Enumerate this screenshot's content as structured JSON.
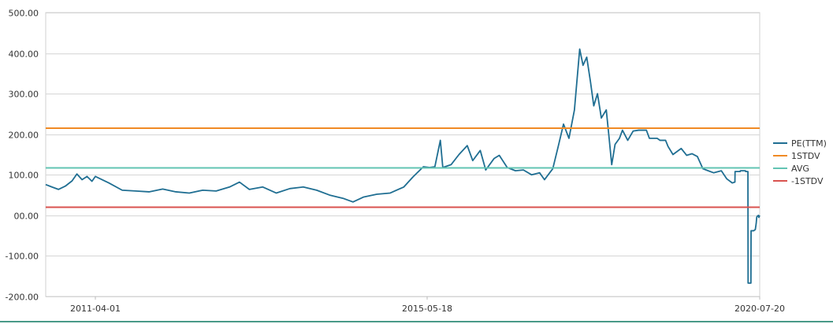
{
  "chart_data": {
    "type": "line",
    "title": "",
    "xlabel": "",
    "ylabel": "",
    "ylim": [
      -200,
      500
    ],
    "y_ticks": [
      "500.00",
      "400.00",
      "300.00",
      "200.00",
      "100.00",
      "00.00",
      "-100.00",
      "-200.00"
    ],
    "y_tick_values": [
      500,
      400,
      300,
      200,
      100,
      0,
      -100,
      -200
    ],
    "x_ticks": [
      "2011-04-01",
      "2015-05-18",
      "2020-07-20"
    ],
    "x_range": [
      "2010-01-04",
      "2020-07-20"
    ],
    "grid": "horizontal",
    "legend_position": "right",
    "series": [
      {
        "name": "PE(TTM)",
        "color": "#1f6e92",
        "points": [
          [
            "2010-01-04",
            76
          ],
          [
            "2010-03-01",
            70
          ],
          [
            "2010-05-01",
            64
          ],
          [
            "2010-07-01",
            72
          ],
          [
            "2010-09-01",
            85
          ],
          [
            "2010-10-15",
            102
          ],
          [
            "2010-12-01",
            88
          ],
          [
            "2011-01-15",
            96
          ],
          [
            "2011-03-01",
            84
          ],
          [
            "2011-04-01",
            96
          ],
          [
            "2011-06-01",
            80
          ],
          [
            "2011-08-01",
            62
          ],
          [
            "2011-10-01",
            60
          ],
          [
            "2011-12-01",
            58
          ],
          [
            "2012-02-01",
            65
          ],
          [
            "2012-04-01",
            58
          ],
          [
            "2012-06-01",
            55
          ],
          [
            "2012-08-01",
            62
          ],
          [
            "2012-10-01",
            60
          ],
          [
            "2012-12-01",
            70
          ],
          [
            "2013-01-15",
            82
          ],
          [
            "2013-03-01",
            64
          ],
          [
            "2013-05-01",
            70
          ],
          [
            "2013-07-01",
            55
          ],
          [
            "2013-09-01",
            66
          ],
          [
            "2013-11-01",
            70
          ],
          [
            "2014-01-01",
            62
          ],
          [
            "2014-03-01",
            50
          ],
          [
            "2014-05-01",
            42
          ],
          [
            "2014-06-15",
            33
          ],
          [
            "2014-08-01",
            45
          ],
          [
            "2014-10-01",
            52
          ],
          [
            "2014-12-01",
            55
          ],
          [
            "2015-02-01",
            70
          ],
          [
            "2015-03-15",
            95
          ],
          [
            "2015-05-01",
            120
          ],
          [
            "2015-06-01",
            118
          ],
          [
            "2015-07-01",
            120
          ],
          [
            "2015-08-01",
            185
          ],
          [
            "2015-08-15",
            118
          ],
          [
            "2015-10-01",
            125
          ],
          [
            "2015-11-15",
            150
          ],
          [
            "2016-01-01",
            172
          ],
          [
            "2016-02-01",
            135
          ],
          [
            "2016-03-15",
            160
          ],
          [
            "2016-04-15",
            112
          ],
          [
            "2016-06-01",
            140
          ],
          [
            "2016-07-01",
            148
          ],
          [
            "2016-08-15",
            118
          ],
          [
            "2016-10-01",
            110
          ],
          [
            "2016-11-15",
            112
          ],
          [
            "2017-01-01",
            100
          ],
          [
            "2017-02-15",
            105
          ],
          [
            "2017-03-15",
            88
          ],
          [
            "2017-05-01",
            115
          ],
          [
            "2017-06-01",
            170
          ],
          [
            "2017-07-01",
            225
          ],
          [
            "2017-08-01",
            190
          ],
          [
            "2017-09-01",
            260
          ],
          [
            "2017-10-01",
            410
          ],
          [
            "2017-10-20",
            370
          ],
          [
            "2017-11-10",
            390
          ],
          [
            "2017-12-01",
            330
          ],
          [
            "2017-12-20",
            270
          ],
          [
            "2018-01-10",
            300
          ],
          [
            "2018-02-01",
            240
          ],
          [
            "2018-03-01",
            260
          ],
          [
            "2018-03-15",
            200
          ],
          [
            "2018-04-01",
            125
          ],
          [
            "2018-04-20",
            175
          ],
          [
            "2018-05-15",
            190
          ],
          [
            "2018-06-01",
            210
          ],
          [
            "2018-07-01",
            185
          ],
          [
            "2018-08-01",
            208
          ],
          [
            "2018-09-01",
            210
          ],
          [
            "2018-10-15",
            210
          ],
          [
            "2018-11-01",
            190
          ],
          [
            "2018-12-15",
            190
          ],
          [
            "2019-01-01",
            185
          ],
          [
            "2019-02-01",
            185
          ],
          [
            "2019-02-15",
            170
          ],
          [
            "2019-03-15",
            150
          ],
          [
            "2019-05-01",
            165
          ],
          [
            "2019-06-01",
            148
          ],
          [
            "2019-07-01",
            152
          ],
          [
            "2019-08-01",
            145
          ],
          [
            "2019-09-01",
            115
          ],
          [
            "2019-10-01",
            110
          ],
          [
            "2019-11-01",
            105
          ],
          [
            "2019-12-15",
            110
          ],
          [
            "2020-01-15",
            90
          ],
          [
            "2020-02-15",
            80
          ],
          [
            "2020-03-01",
            82
          ],
          [
            "2020-03-02",
            108
          ],
          [
            "2020-03-31",
            108
          ],
          [
            "2020-04-01",
            110
          ],
          [
            "2020-04-30",
            110
          ],
          [
            "2020-05-01",
            108
          ],
          [
            "2020-05-14",
            108
          ],
          [
            "2020-05-15",
            -167
          ],
          [
            "2020-05-31",
            -167
          ],
          [
            "2020-06-01",
            -38
          ],
          [
            "2020-06-15",
            -38
          ],
          [
            "2020-06-25",
            -35
          ],
          [
            "2020-06-30",
            -20
          ],
          [
            "2020-07-03",
            -5
          ],
          [
            "2020-07-06",
            -2
          ],
          [
            "2020-07-10",
            -1
          ],
          [
            "2020-07-13",
            0
          ],
          [
            "2020-07-15",
            -5
          ],
          [
            "2020-07-17",
            -3
          ],
          [
            "2020-07-20",
            0
          ]
        ]
      },
      {
        "name": "1STDV",
        "color": "#f08a24",
        "constant": 215
      },
      {
        "name": "AVG",
        "color": "#62c4b3",
        "constant": 117
      },
      {
        "name": "-1STDV",
        "color": "#d9534f",
        "constant": 20
      }
    ]
  }
}
